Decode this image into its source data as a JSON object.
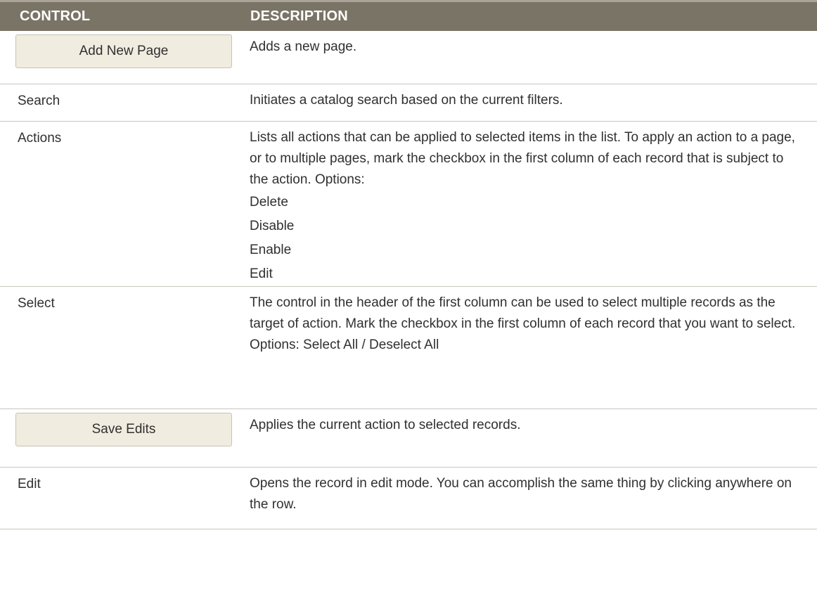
{
  "header": {
    "control": "CONTROL",
    "description": "DESCRIPTION"
  },
  "rows": [
    {
      "control": "Add New Page",
      "control_is_button": true,
      "description": "Adds a new page."
    },
    {
      "control": "Search",
      "control_is_button": false,
      "description": "Initiates a catalog search based on the current filters."
    },
    {
      "control": "Actions",
      "control_is_button": false,
      "description": "Lists all actions that can be applied to selected items in the list. To apply an action to a page, or to multiple pages, mark the checkbox in the first column of each record that is subject to the action. Options:",
      "options": [
        "Delete",
        "Disable",
        "Enable",
        "Edit"
      ]
    },
    {
      "control": "Select",
      "control_is_button": false,
      "description": "The control in the header of the first column can be used to select multiple records as the target of action. Mark the checkbox in the first column of each record that you want to select. Options: Select All / Deselect All"
    },
    {
      "control": "Save Edits",
      "control_is_button": true,
      "description": "Applies the current action to selected records."
    },
    {
      "control": "Edit",
      "control_is_button": false,
      "description": "Opens the record in edit mode. You can accomplish the same thing by clicking anywhere on the row."
    }
  ],
  "colors": {
    "header_bg": "#7a7466",
    "header_text": "#ffffff",
    "button_bg": "#f1ece0",
    "row_divider": "#c9c6bf"
  }
}
